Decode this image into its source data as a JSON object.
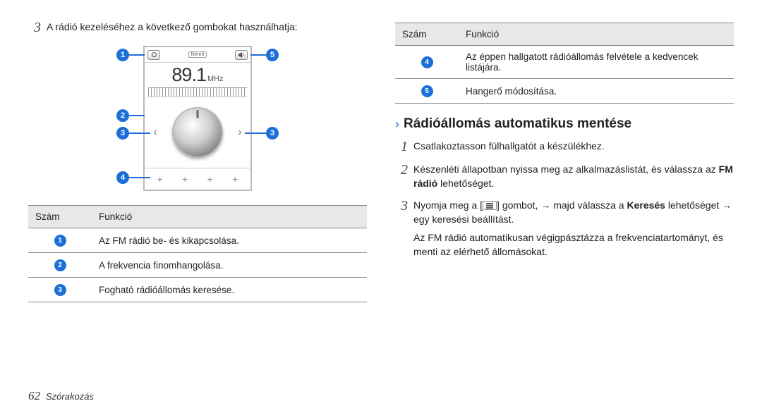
{
  "left": {
    "step3_num": "3",
    "step3_text": "A rádió kezeléséhez a következő gombokat használhatja:",
    "radio": {
      "mute_label": "Némít",
      "freq_value": "89.1",
      "freq_unit": "MHz"
    },
    "callouts": {
      "c1": "1",
      "c2": "2",
      "c3": "3",
      "c4": "4",
      "c5": "5"
    },
    "table": {
      "head_num": "Szám",
      "head_func": "Funkció",
      "rows": [
        {
          "n": "1",
          "f": "Az FM rádió be- és kikapcsolása."
        },
        {
          "n": "2",
          "f": "A frekvencia finomhangolása."
        },
        {
          "n": "3",
          "f": "Fogható rádióállomás keresése."
        }
      ]
    }
  },
  "right": {
    "table": {
      "head_num": "Szám",
      "head_func": "Funkció",
      "rows": [
        {
          "n": "4",
          "f": "Az éppen hallgatott rádióállomás felvétele a kedvencek listájára."
        },
        {
          "n": "5",
          "f": "Hangerő módosítása."
        }
      ]
    },
    "subheading": "Rádióállomás automatikus mentése",
    "steps": {
      "s1_num": "1",
      "s1_text": "Csatlakoztasson fülhallgatót a készülékhez.",
      "s2_num": "2",
      "s2_pre": "Készenléti állapotban nyissa meg az alkalmazáslistát, és válassza az ",
      "s2_bold": "FM rádió",
      "s2_post": " lehetőséget.",
      "s3_num": "3",
      "s3_pre": "Nyomja meg a [",
      "s3_mid": "] gombot, → majd válassza a ",
      "s3_bold": "Keresés",
      "s3_post": " lehetőséget → egy keresési beállítást.",
      "s3_note": "Az FM rádió automatikusan végigpásztázza a frekvenciatartományt, és menti az elérhető állomásokat."
    }
  },
  "footer": {
    "page": "62",
    "section": "Szórakozás"
  }
}
